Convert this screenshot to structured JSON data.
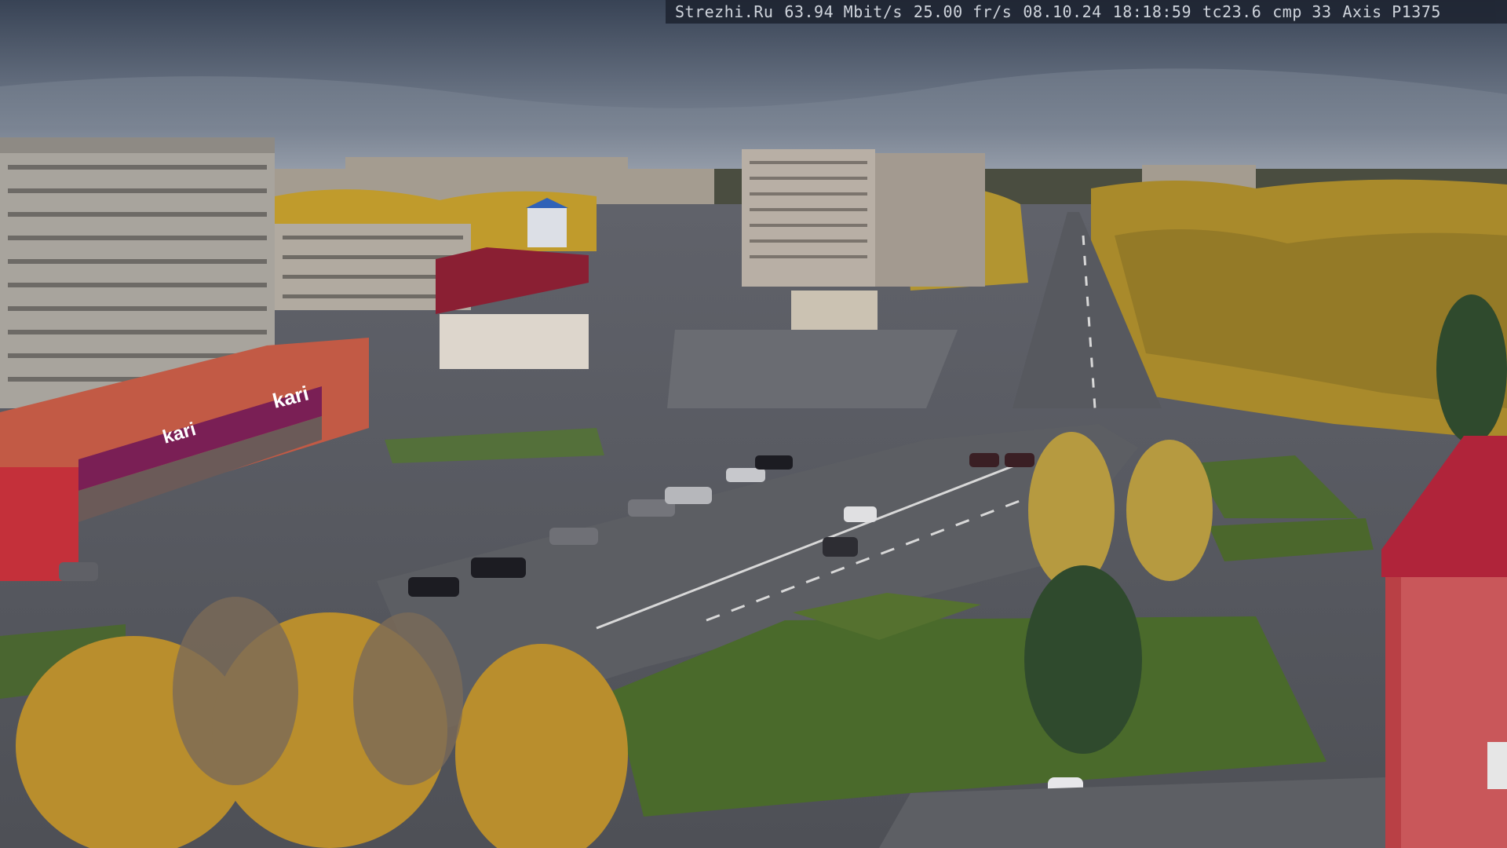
{
  "overlay": {
    "site": "Strezhi.Ru",
    "bitrate": "63.94 Mbit/s",
    "framerate": "25.00 fr/s",
    "date": "08.10.24",
    "time": "18:18:59",
    "tc": "tc23.6",
    "cmp": "cmp 33",
    "camera": "Axis P1375"
  },
  "signs": {
    "store_brand": "kari",
    "store_brand_left": "kari"
  },
  "colors": {
    "sky_top": "#3c4656",
    "sky_bottom": "#8a94a3",
    "foliage_yellow": "#c9a227",
    "lawn_green": "#4b6b2e",
    "asphalt": "#5a5c62",
    "store_facade": "#c25a45",
    "store_sign": "#7a1f55",
    "roof_red": "#b0243a"
  }
}
